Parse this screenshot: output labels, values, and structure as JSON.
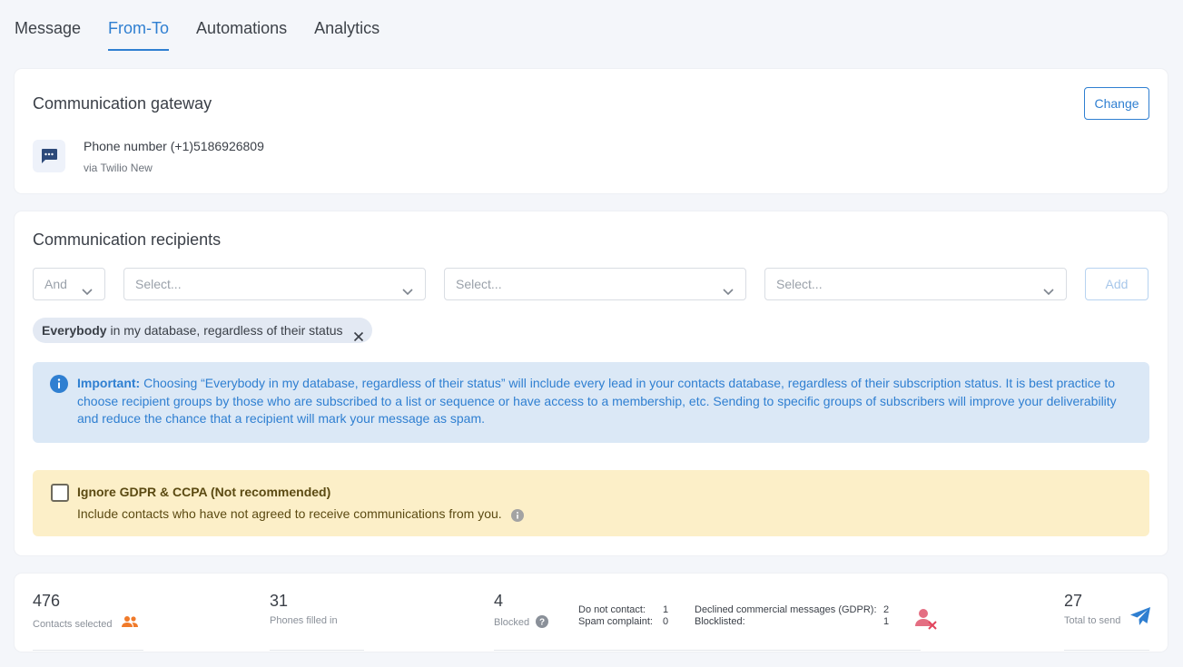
{
  "tabs": [
    {
      "label": "Message"
    },
    {
      "label": "From-To",
      "active": true
    },
    {
      "label": "Automations"
    },
    {
      "label": "Analytics"
    }
  ],
  "gateway": {
    "title": "Communication gateway",
    "change_label": "Change",
    "phone": "Phone number (+1)5186926809",
    "via": "via Twilio New",
    "icon": "chat-bubble-icon"
  },
  "recipients": {
    "title": "Communication recipients",
    "operator": "And",
    "select_placeholder": "Select...",
    "add_label": "Add",
    "chip_bold": "Everybody",
    "chip_rest": " in my database, regardless of their status",
    "info_bold": "Important:",
    "info_text": " Choosing “Everybody in my database, regardless of their status” will include every lead in your contacts database, regardless of their subscription status. It is best practice to choose recipient groups by those who are subscribed to a list or sequence or have access to a membership, etc. Sending to specific groups of subscribers will improve your deliverability and reduce the chance that a recipient will mark your message as spam.",
    "gdpr_title": "Ignore GDPR & CCPA (Not recommended)",
    "gdpr_sub": "Include contacts who have not agreed to receive communications from you.",
    "gdpr_checked": false
  },
  "stats": {
    "contacts_selected": {
      "value": "476",
      "label": "Contacts selected"
    },
    "phones_filled": {
      "value": "31",
      "label": "Phones filled in"
    },
    "blocked": {
      "value": "4",
      "label": "Blocked"
    },
    "do_not_contact": {
      "label": "Do not contact:",
      "value": "1"
    },
    "spam_complaint": {
      "label": "Spam complaint:",
      "value": "0"
    },
    "declined": {
      "label": "Declined commercial messages (GDPR):",
      "value": "2"
    },
    "blocklisted": {
      "label": "Blocklisted:",
      "value": "1"
    },
    "total_to_send": {
      "value": "27",
      "label": "Total to send"
    }
  },
  "colors": {
    "accent": "#2f7fd1",
    "info_bg": "#dbe8f6",
    "warn_bg": "#fcefc8",
    "orange": "#f07a2a",
    "danger": "#e2455d"
  }
}
